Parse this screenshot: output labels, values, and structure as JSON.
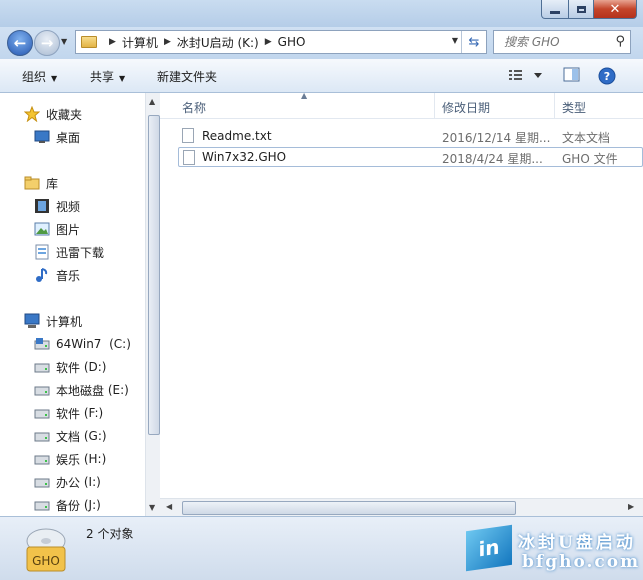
{
  "address": {
    "crumbs": [
      "计算机",
      "冰封U启动 (K:)",
      "GHO"
    ]
  },
  "search": {
    "placeholder": "搜索 GHO"
  },
  "toolbar": {
    "organize": "组织",
    "share": "共享",
    "new_folder": "新建文件夹"
  },
  "sidebar": {
    "favorites": "收藏夹",
    "desktop": "桌面",
    "libraries": "库",
    "video": "视频",
    "pictures": "图片",
    "thunder": "迅雷下载",
    "music": "音乐",
    "computer": "计算机",
    "drives": [
      {
        "label": "64Win7",
        "letter": "(C:)"
      },
      {
        "label": "软件",
        "letter": "(D:)"
      },
      {
        "label": "本地磁盘",
        "letter": "(E:)"
      },
      {
        "label": "软件",
        "letter": "(F:)"
      },
      {
        "label": "文档",
        "letter": "(G:)"
      },
      {
        "label": "娱乐",
        "letter": "(H:)"
      },
      {
        "label": "办公",
        "letter": "(I:)"
      },
      {
        "label": "备份",
        "letter": "(J:)"
      }
    ]
  },
  "columns": {
    "name": "名称",
    "date": "修改日期",
    "type": "类型"
  },
  "files": [
    {
      "name": "Readme.txt",
      "date": "2016/12/14 星期...",
      "type": "文本文档",
      "selected": false
    },
    {
      "name": "Win7x32.GHO",
      "date": "2018/4/24 星期...",
      "type": "GHO 文件",
      "selected": true
    }
  ],
  "status": {
    "count": "2 个对象",
    "icon_label": "GHO"
  },
  "watermark": {
    "line1": "冰封U盘启动",
    "line2": "bfgho.com",
    "logo": "in"
  },
  "colors": {
    "accent": "#3568b4",
    "selection_border": "#a5bcd9",
    "chrome": "#bfd3ea"
  }
}
